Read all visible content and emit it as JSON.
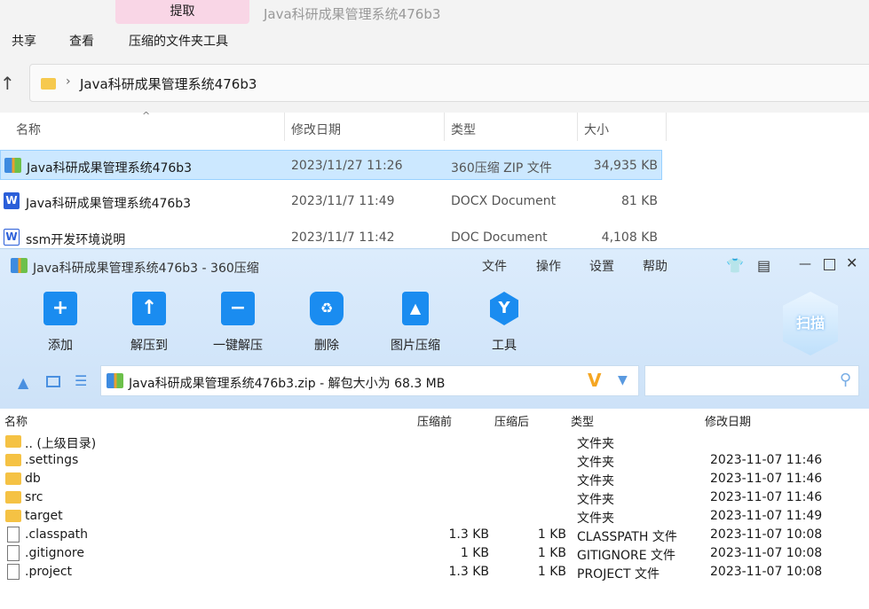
{
  "explorer": {
    "ribbon_tab": "提取",
    "window_title": "Java科研成果管理系统476b3",
    "menu": [
      "共享",
      "查看",
      "压缩的文件夹工具"
    ],
    "address": "Java科研成果管理系统476b3",
    "columns": [
      "名称",
      "修改日期",
      "类型",
      "大小"
    ],
    "files": [
      {
        "name": "Java科研成果管理系统476b3",
        "date": "2023/11/27 11:26",
        "type": "360压缩 ZIP 文件",
        "size": "34,935 KB",
        "icon": "zip-icon"
      },
      {
        "name": "Java科研成果管理系统476b3",
        "date": "2023/11/7 11:49",
        "type": "DOCX Document",
        "size": "81 KB",
        "icon": "word-icon"
      },
      {
        "name": "ssm开发环境说明",
        "date": "2023/11/7 11:42",
        "type": "DOC Document",
        "size": "4,108 KB",
        "icon": "word-icon"
      }
    ]
  },
  "zip": {
    "title": "Java科研成果管理系统476b3 - 360压缩",
    "menu": [
      "文件",
      "操作",
      "设置",
      "帮助"
    ],
    "toolbar": [
      "添加",
      "解压到",
      "一键解压",
      "删除",
      "图片压缩",
      "工具"
    ],
    "scan": "扫描",
    "address": "Java科研成果管理系统476b3.zip - 解包大小为 68.3 MB",
    "columns": [
      "名称",
      "压缩前",
      "压缩后",
      "类型",
      "修改日期"
    ],
    "rows": [
      {
        "name": ".. (上级目录)",
        "before": "",
        "after": "",
        "type": "文件夹",
        "date": "",
        "folder": true
      },
      {
        "name": ".settings",
        "before": "",
        "after": "",
        "type": "文件夹",
        "date": "2023-11-07 11:46",
        "folder": true
      },
      {
        "name": "db",
        "before": "",
        "after": "",
        "type": "文件夹",
        "date": "2023-11-07 11:46",
        "folder": true
      },
      {
        "name": "src",
        "before": "",
        "after": "",
        "type": "文件夹",
        "date": "2023-11-07 11:46",
        "folder": true
      },
      {
        "name": "target",
        "before": "",
        "after": "",
        "type": "文件夹",
        "date": "2023-11-07 11:49",
        "folder": true
      },
      {
        "name": ".classpath",
        "before": "1.3 KB",
        "after": "1 KB",
        "type": "CLASSPATH 文件",
        "date": "2023-11-07 10:08",
        "folder": false
      },
      {
        "name": ".gitignore",
        "before": "1 KB",
        "after": "1 KB",
        "type": "GITIGNORE 文件",
        "date": "2023-11-07 10:08",
        "folder": false
      },
      {
        "name": ".project",
        "before": "1.3 KB",
        "after": "1 KB",
        "type": "PROJECT 文件",
        "date": "2023-11-07 10:08",
        "folder": false
      }
    ]
  }
}
